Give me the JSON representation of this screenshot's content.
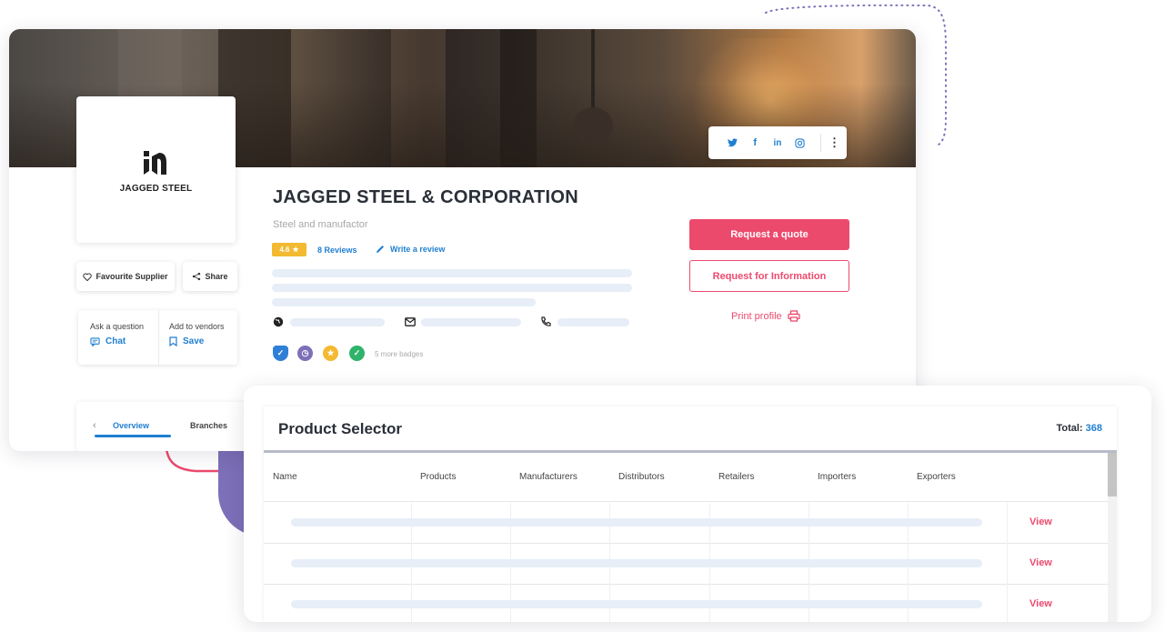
{
  "company": {
    "logo_text": "JAGGED STEEL",
    "name": "JAGGED STEEL & CORPORATION",
    "tagline": "Steel and manufactor",
    "rating": "4.6",
    "reviews_label": "8 Reviews",
    "write_review_label": "Write a review",
    "more_badges_label": "5 more badges"
  },
  "social": {
    "icons": [
      "twitter-icon",
      "facebook-icon",
      "linkedin-icon",
      "instagram-icon",
      "more-vertical-icon"
    ]
  },
  "actions": {
    "favourite_label": "Favourite Supplier",
    "share_label": "Share",
    "ask_question_label": "Ask a question",
    "chat_label": "Chat",
    "add_vendors_label": "Add to vendors",
    "save_label": "Save",
    "request_quote_label": "Request a quote",
    "request_info_label": "Request for Information",
    "print_profile_label": "Print profile"
  },
  "tabs": [
    {
      "label": "Overview"
    },
    {
      "label": "Branches"
    }
  ],
  "product_selector": {
    "title": "Product Selector",
    "total_label": "Total:",
    "total_value": "368",
    "columns": [
      "Name",
      "Products",
      "Manufacturers",
      "Distributors",
      "Retailers",
      "Importers",
      "Exporters"
    ],
    "rows": [
      {
        "action": "View"
      },
      {
        "action": "View"
      },
      {
        "action": "View"
      }
    ]
  },
  "colors": {
    "accent_pink": "#ec4a6d",
    "link_blue": "#1f7fd1",
    "rating_yellow": "#f2b931",
    "skeleton": "#e7eef7",
    "deco_purple": "#7d6fb8"
  }
}
